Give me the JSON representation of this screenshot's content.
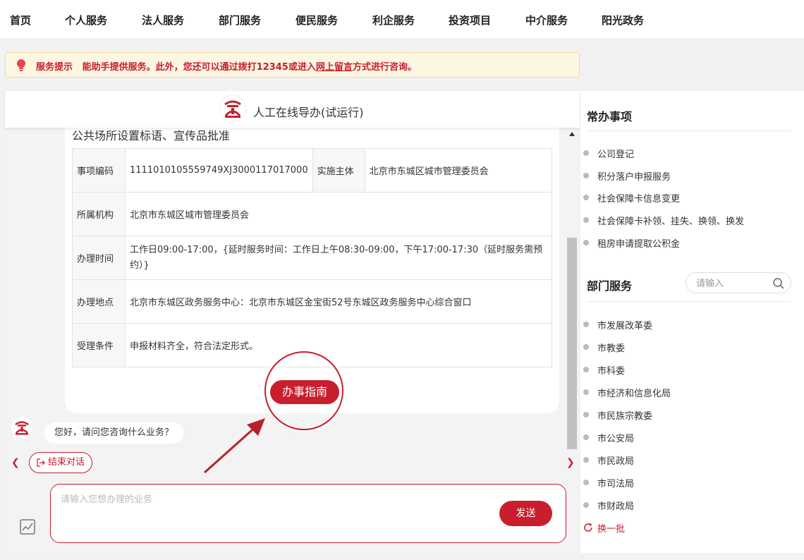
{
  "nav": {
    "items": [
      "首页",
      "个人服务",
      "法人服务",
      "部门服务",
      "便民服务",
      "利企服务",
      "投资项目",
      "中介服务",
      "阳光政务"
    ]
  },
  "notice": {
    "label": "服务提示",
    "text_before": "能助手提供服务。此外，您还可以通过拨打12345或进入",
    "link": "网上留言",
    "text_after": "方式进行咨询。"
  },
  "chat": {
    "header_title": "人工在线导办(试运行)",
    "card_title": "公共场所设置标语、宣传品批准",
    "table": {
      "code_label": "事项编码",
      "code_value": "1111010105559749XJ3000117017000",
      "subject_label": "实施主体",
      "subject_value": "北京市东城区城市管理委员会",
      "org_label": "所属机构",
      "org_value": "北京市东城区城市管理委员会",
      "time_label": "办理时间",
      "time_value": "工作日09:00-17:00，{延时服务时间：工作日上午08:30-09:00，下午17:00-17:30（延时服务需预约）}",
      "place_label": "办理地点",
      "place_value": "北京市东城区政务服务中心：北京市东城区金宝街52号东城区政务服务中心综合窗口",
      "cond_label": "受理条件",
      "cond_value": "申报材料齐全，符合法定形式。"
    },
    "guide_button": "办事指南",
    "bot_message": "您好，请问您咨询什么业务？",
    "end_button": "结束对话",
    "input_placeholder": "请输入您想办理的业务",
    "send_button": "发送"
  },
  "sidebar": {
    "common_title": "常办事项",
    "common_items": [
      "公司登记",
      "积分落户申报服务",
      "社会保障卡信息变更",
      "社会保障卡补领、挂失、换领、换发",
      "租房申请提取公积金"
    ],
    "dept_title": "部门服务",
    "dept_search_placeholder": "请输入",
    "dept_items": [
      "市发展改革委",
      "市教委",
      "市科委",
      "市经济和信息化局",
      "市民族宗教委",
      "市公安局",
      "市民政局",
      "市司法局",
      "市财政局"
    ],
    "refresh_label": "换一批"
  },
  "colors": {
    "accent": "#c81e2e",
    "notice_bg": "#fdf6e3"
  }
}
